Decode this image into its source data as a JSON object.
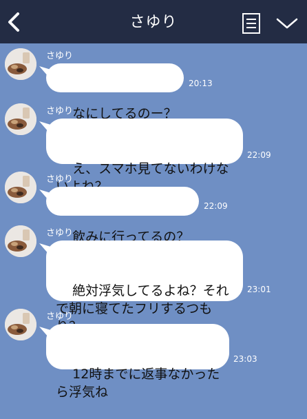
{
  "header": {
    "title": "さゆり"
  },
  "colors": {
    "header_bg": "#232c44",
    "chat_bg": "#6f8fc4",
    "bubble_bg": "#ffffff"
  },
  "icons": {
    "back": "chevron-left-icon",
    "memo": "memo-icon",
    "menu": "chevron-down-icon",
    "avatar": "avatar-photo"
  },
  "messages": [
    {
      "sender": "さゆり",
      "text": "なにしてるのー？",
      "time": "20:13"
    },
    {
      "sender": "さゆり",
      "text": "え、スマホ見てないわけな\nいよね？",
      "time": "22:09"
    },
    {
      "sender": "さゆり",
      "text": "飲みに行ってるの？",
      "time": "22:09"
    },
    {
      "sender": "さゆり",
      "text": "絶対浮気してるよね？それ\nで朝に寝てたフリするつも\nり？",
      "time": "23:01"
    },
    {
      "sender": "さゆり",
      "text": "12時までに返事なかった\nら浮気ね",
      "time": "23:03"
    }
  ]
}
